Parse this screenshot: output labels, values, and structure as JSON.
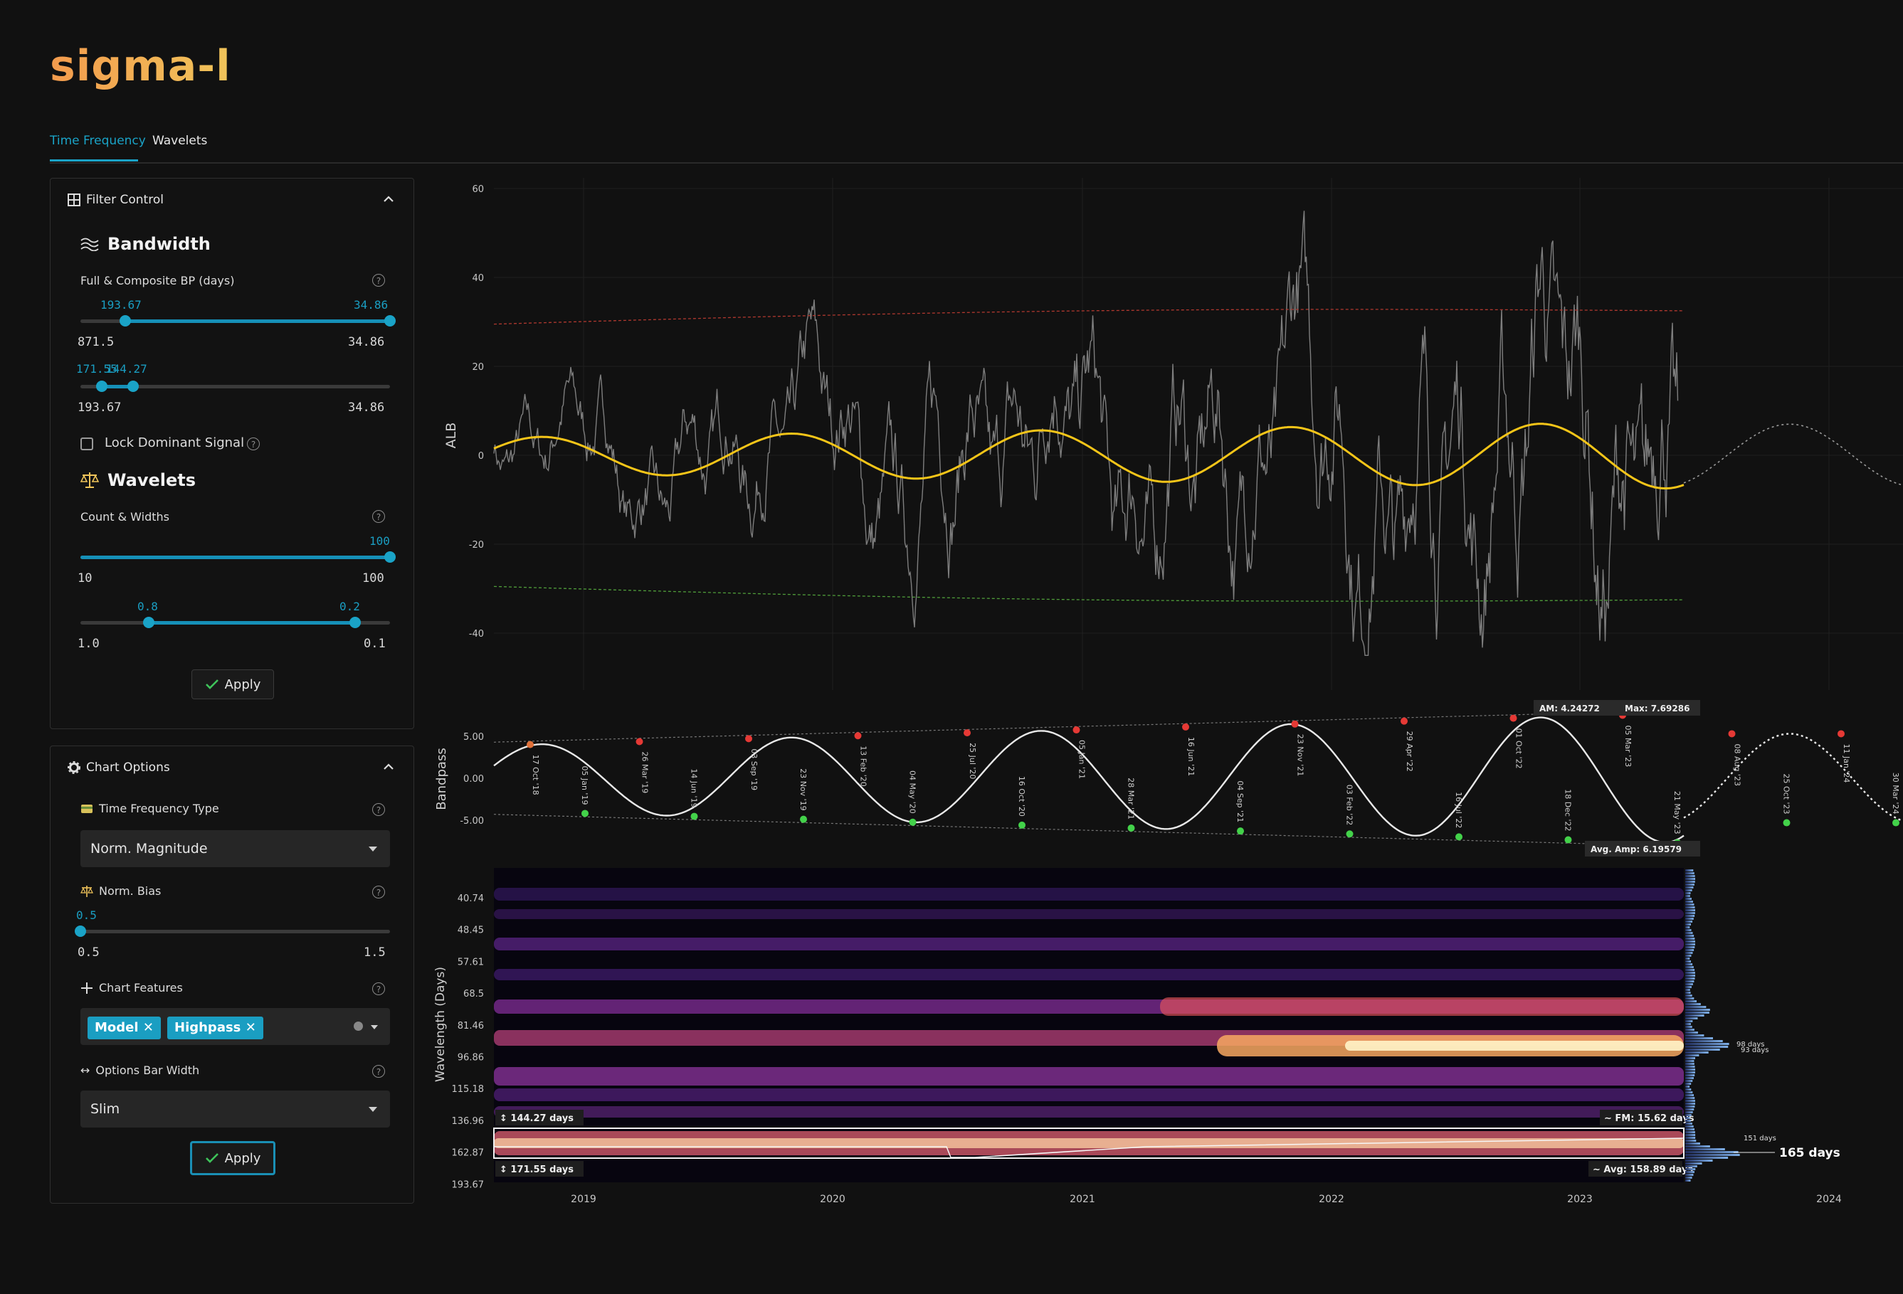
{
  "app": {
    "title": "sigma-l"
  },
  "tabs": [
    {
      "label": "Time Frequency",
      "active": true
    },
    {
      "label": "Wavelets",
      "active": false
    }
  ],
  "filter_control": {
    "title": "Filter Control",
    "bandwidth": {
      "title": "Bandwidth",
      "label": "Full & Composite BP (days)",
      "slider1": {
        "low_label": "193.67",
        "high_label": "34.86",
        "min": "871.5",
        "max": "34.86",
        "low": 193.67,
        "high": 34.86
      },
      "slider2": {
        "low_label": "171.55",
        "high_label": "144.27",
        "min": "193.67",
        "max": "34.86",
        "low": 171.55,
        "high": 144.27
      }
    },
    "lock_dominant": {
      "label": "Lock Dominant Signal",
      "checked": false
    },
    "wavelets": {
      "title": "Wavelets",
      "label": "Count & Widths",
      "count": {
        "value_label": "100",
        "min": "10",
        "max": "100",
        "value": 100
      },
      "widths": {
        "low_label": "0.8",
        "high_label": "0.2",
        "min": "1.0",
        "max": "0.1",
        "low": 0.8,
        "high": 0.2
      }
    },
    "apply_label": "Apply"
  },
  "chart_options": {
    "title": "Chart Options",
    "tf_type": {
      "label": "Time Frequency Type",
      "value": "Norm. Magnitude"
    },
    "norm_bias": {
      "label": "Norm. Bias",
      "value_label": "0.5",
      "min": "0.5",
      "max": "1.5",
      "value": 0.5
    },
    "features": {
      "label": "Chart Features",
      "chips": [
        "Model",
        "Highpass"
      ]
    },
    "bar_width": {
      "label": "Options Bar Width",
      "value": "Slim"
    },
    "apply_label": "Apply"
  },
  "colors": {
    "accent": "#1aa3c7",
    "bandpass": "#f5c518",
    "envelope_top": "#c0392b",
    "envelope_bottom": "#4caf50",
    "price": "#8a8a8a"
  },
  "chart_data": [
    {
      "type": "line",
      "ylabel": "ALB",
      "yticks": [
        60,
        40,
        20,
        0,
        -20,
        -40
      ],
      "ylim": [
        -46,
        60
      ],
      "xticks": [
        "2019",
        "2020",
        "2021",
        "2022",
        "2023",
        "2024"
      ],
      "series": [],
      "bandpass": {
        "period_days": 158.89,
        "amp_start": 4.0,
        "amp_end": 7.5
      },
      "envelope_upper": {
        "start": 29.5,
        "end": 32.5
      },
      "envelope_lower": {
        "start": -29.5,
        "end": -32.5
      }
    },
    {
      "type": "line",
      "ylabel": "Bandpass",
      "yticks": [
        "5.00",
        "0.00",
        "-5.00"
      ],
      "annotations": {
        "am": "AM: 4.24272",
        "max": "Max: 7.69286",
        "avg_amp": "Avg. Amp: 6.19579"
      },
      "peaks": [
        "17 Oct '18",
        "26 Mar '19",
        "03 Sep '19",
        "13 Feb '20",
        "25 Jul '20",
        "05 Jan '21",
        "16 Jun '21",
        "23 Nov '21",
        "29 Apr '22",
        "01 Oct '22",
        "05 Mar '23",
        "08 Aug '23",
        "11 Jan '24"
      ],
      "troughs": [
        "05 Jan '19",
        "14 Jun '19",
        "23 Nov '19",
        "04 May '20",
        "16 Oct '20",
        "28 Mar '21",
        "04 Sep '21",
        "03 Feb '22",
        "16 Jul '22",
        "18 Dec '22",
        "21 May '23",
        "25 Oct '23",
        "30 Mar '24"
      ]
    },
    {
      "type": "heatmap",
      "ylabel": "Wavelength (Days)",
      "yticks": [
        "40.74",
        "48.45",
        "57.61",
        "68.5",
        "81.46",
        "96.86",
        "115.18",
        "136.96",
        "162.87",
        "193.67"
      ],
      "xticks": [
        "2019",
        "2020",
        "2021",
        "2022",
        "2023",
        "2024"
      ],
      "band": {
        "top_label": "144.27 days",
        "bottom_label": "171.55 days",
        "fm_label": "FM: 15.62 days",
        "avg_label": "Avg: 158.89 days"
      },
      "spectrum_labels": {
        "p98": "98 days",
        "p93": "93 days",
        "p151": "151 days",
        "p165": "165 days"
      }
    }
  ]
}
